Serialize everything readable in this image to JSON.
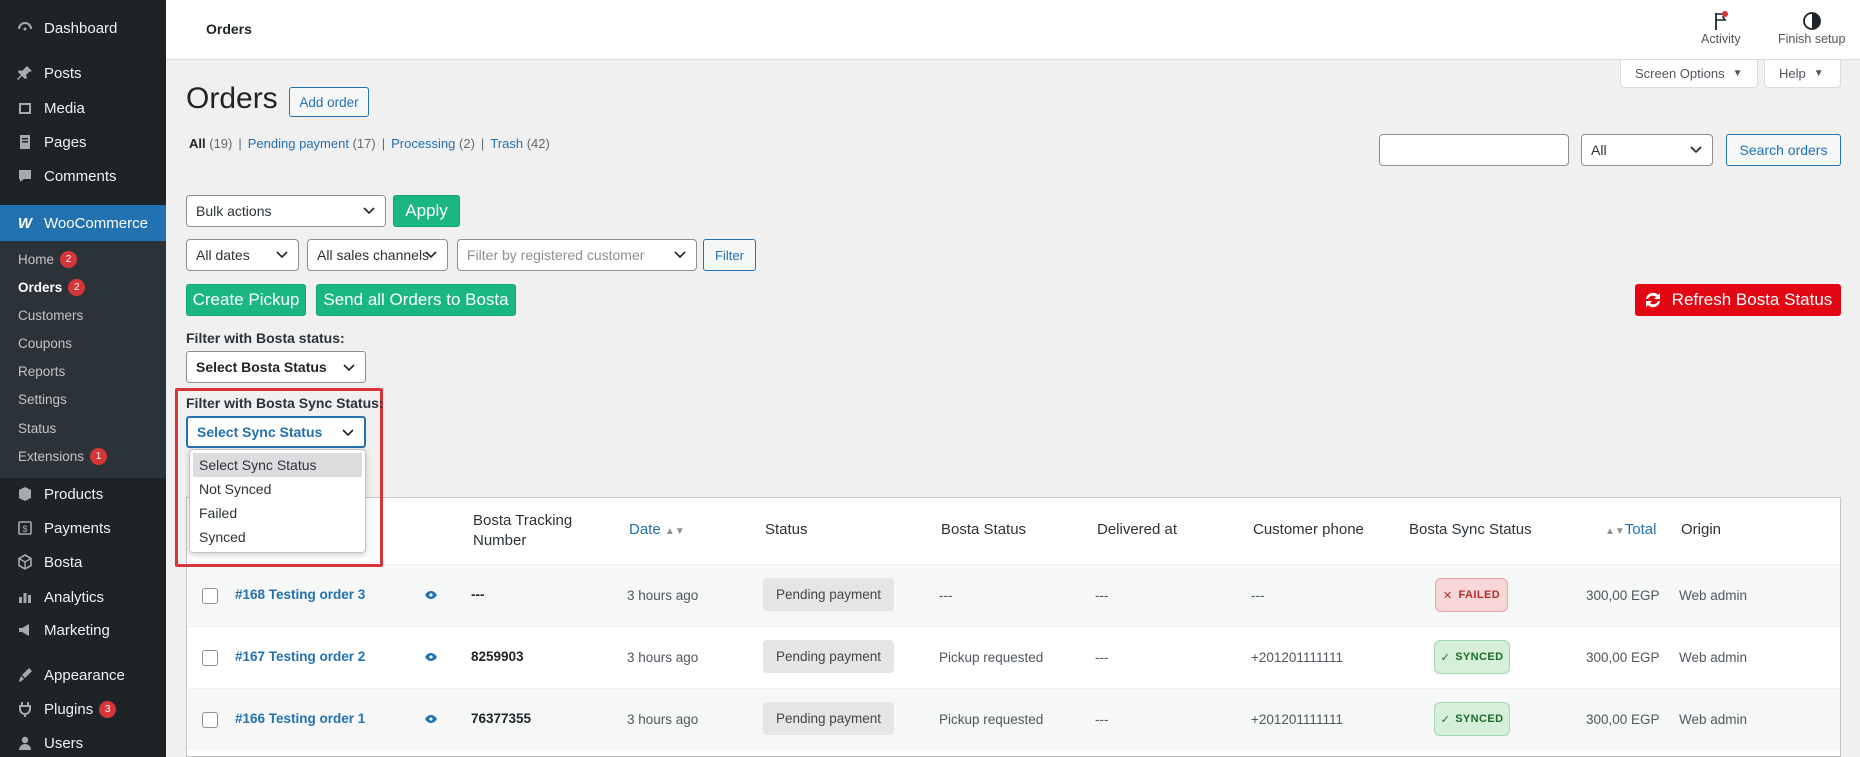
{
  "sidebar": {
    "items_top": [
      {
        "label": "Dashboard",
        "icon": "dashboard-icon"
      },
      {
        "label": "Posts",
        "icon": "pin-icon"
      },
      {
        "label": "Media",
        "icon": "media-icon"
      },
      {
        "label": "Pages",
        "icon": "pages-icon"
      },
      {
        "label": "Comments",
        "icon": "comment-icon"
      }
    ],
    "woocommerce": {
      "label": "WooCommerce",
      "icon": "woocommerce-icon"
    },
    "submenu": [
      {
        "label": "Home",
        "badge": "2"
      },
      {
        "label": "Orders",
        "badge": "2"
      },
      {
        "label": "Customers"
      },
      {
        "label": "Coupons"
      },
      {
        "label": "Reports"
      },
      {
        "label": "Settings"
      },
      {
        "label": "Status"
      },
      {
        "label": "Extensions",
        "badge": "1"
      }
    ],
    "items_bottom": [
      {
        "label": "Products",
        "icon": "products-icon"
      },
      {
        "label": "Payments",
        "icon": "payments-icon"
      },
      {
        "label": "Bosta",
        "icon": "bosta-icon"
      },
      {
        "label": "Analytics",
        "icon": "analytics-icon"
      },
      {
        "label": "Marketing",
        "icon": "marketing-icon"
      },
      {
        "label": "Appearance",
        "icon": "appearance-icon"
      },
      {
        "label": "Plugins",
        "icon": "plugins-icon",
        "badge": "3"
      },
      {
        "label": "Users",
        "icon": "users-icon"
      }
    ]
  },
  "topbar": {
    "title": "Orders",
    "activity_label": "Activity",
    "finish_setup_label": "Finish setup",
    "screen_options_label": "Screen Options",
    "help_label": "Help"
  },
  "page": {
    "title": "Orders",
    "add_order_label": "Add order",
    "views": [
      {
        "label": "All",
        "count": "(19)"
      },
      {
        "label": "Pending payment",
        "count": "(17)"
      },
      {
        "label": "Processing",
        "count": "(2)"
      },
      {
        "label": "Trash",
        "count": "(42)"
      }
    ],
    "separator": "|",
    "search": {
      "value": "",
      "status_select": "All",
      "button_label": "Search orders"
    },
    "bulk_actions": "Bulk actions",
    "apply_label": "Apply",
    "filters": {
      "dates": "All dates",
      "channels": "All sales channels",
      "customer_placeholder": "Filter by registered customer",
      "filter_button": "Filter"
    },
    "create_pickup_label": "Create Pickup",
    "send_all_label": "Send all Orders to Bosta",
    "refresh_label": "Refresh Bosta Status",
    "bosta_status_label": "Filter with Bosta status:",
    "bosta_status_select": "Select Bosta Status",
    "sync_status_label": "Filter with Bosta Sync Status:",
    "sync_status_select": "Select Sync Status",
    "sync_options": [
      "Select Sync Status",
      "Not Synced",
      "Failed",
      "Synced"
    ]
  },
  "table": {
    "headers": {
      "tracking": "Bosta Tracking Number",
      "date": "Date",
      "status": "Status",
      "bosta_status": "Bosta Status",
      "delivered_at": "Delivered at",
      "phone": "Customer phone",
      "sync": "Bosta Sync Status",
      "total": "Total",
      "origin": "Origin"
    },
    "rows": [
      {
        "order": "#168 Testing order 3",
        "tracking": "---",
        "date": "3 hours ago",
        "status": "Pending payment",
        "bosta_status": "---",
        "delivered_at": "---",
        "phone": "---",
        "sync": "FAILED",
        "sync_mark": "✕",
        "total": "300,00 EGP",
        "origin": "Web admin"
      },
      {
        "order": "#167 Testing order 2",
        "tracking": "8259903",
        "date": "3 hours ago",
        "status": "Pending payment",
        "bosta_status": "Pickup requested",
        "delivered_at": "---",
        "phone": "+201201111111",
        "sync": "SYNCED",
        "sync_mark": "✓",
        "total": "300,00 EGP",
        "origin": "Web admin"
      },
      {
        "order": "#166 Testing order 1",
        "tracking": "76377355",
        "date": "3 hours ago",
        "status": "Pending payment",
        "bosta_status": "Pickup requested",
        "delivered_at": "---",
        "phone": "+201201111111",
        "sync": "SYNCED",
        "sync_mark": "✓",
        "total": "300,00 EGP",
        "origin": "Web admin"
      }
    ]
  }
}
